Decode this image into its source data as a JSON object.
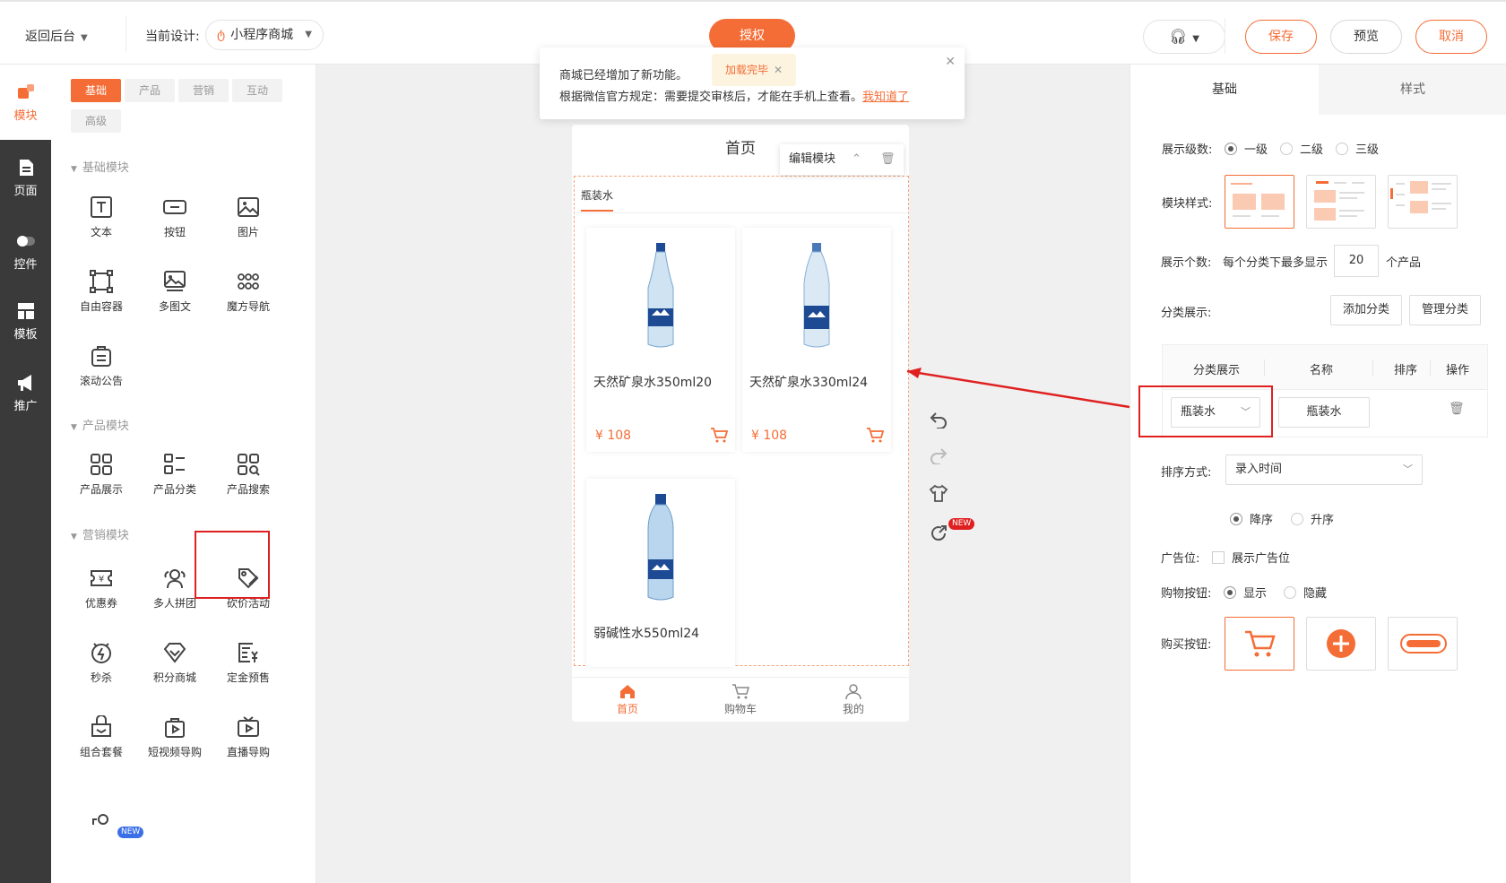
{
  "topbar": {
    "back_label": "返回后台",
    "current_design_label": "当前设计:",
    "design_name": "小程序商城",
    "auth_label": "授权",
    "save_label": "保存",
    "preview_label": "预览",
    "cancel_label": "取消"
  },
  "leftnav": {
    "items": [
      {
        "label": "模块"
      },
      {
        "label": "页面"
      },
      {
        "label": "控件"
      },
      {
        "label": "模板"
      },
      {
        "label": "推广"
      }
    ]
  },
  "modules": {
    "tabs": [
      "基础",
      "产品",
      "营销",
      "互动",
      "高级"
    ],
    "sections": {
      "basic": "基础模块",
      "product": "产品模块",
      "marketing": "营销模块"
    },
    "basic_items": [
      "文本",
      "按钮",
      "图片",
      "自由容器",
      "多图文",
      "魔方导航",
      "滚动公告"
    ],
    "product_items": [
      "产品展示",
      "产品分类",
      "产品搜索"
    ],
    "marketing_items": [
      "优惠券",
      "多人拼团",
      "砍价活动",
      "秒杀",
      "积分商城",
      "定金预售",
      "组合套餐",
      "短视频导购",
      "直播导购"
    ],
    "new_badge": "NEW"
  },
  "notice": {
    "line1": "商城已经增加了新功能。",
    "line2_prefix": "根据微信官方规定：需要提交审核后，才能在手机上查看。",
    "line2_link": "我知道了",
    "loaded_tag": "加载完毕"
  },
  "phone": {
    "title": "首页",
    "edit_label": "编辑模块",
    "category_tab": "瓶装水",
    "products": [
      {
        "name": "天然矿泉水350ml20",
        "price": "¥ 108"
      },
      {
        "name": "天然矿泉水330ml24",
        "price": "¥ 108"
      },
      {
        "name": "弱碱性水550ml24",
        "price": ""
      }
    ],
    "footer": [
      "首页",
      "购物车",
      "我的"
    ],
    "new_badge": "NEW"
  },
  "right": {
    "tabs": [
      "基础",
      "样式"
    ],
    "level_label": "展示级数:",
    "levels": [
      "一级",
      "二级",
      "三级"
    ],
    "style_label": "模块样式:",
    "count_label": "展示个数:",
    "count_prefix": "每个分类下最多显示",
    "count_value": "20",
    "count_suffix": "个产品",
    "cat_label": "分类展示:",
    "add_cat": "添加分类",
    "manage_cat": "管理分类",
    "table_headers": [
      "分类展示",
      "名称",
      "排序",
      "操作"
    ],
    "row_select": "瓶装水",
    "row_name": "瓶装水",
    "sort_label": "排序方式:",
    "sort_value": "录入时间",
    "order_options": [
      "降序",
      "升序"
    ],
    "ad_label": "广告位:",
    "ad_option": "展示广告位",
    "cart_btn_label": "购物按钮:",
    "cart_btn_options": [
      "显示",
      "隐藏"
    ],
    "buy_btn_label": "购买按钮:"
  },
  "colors": {
    "accent": "#f56d36",
    "highlight": "#e02020",
    "nav_bg": "#3a3a3a"
  }
}
